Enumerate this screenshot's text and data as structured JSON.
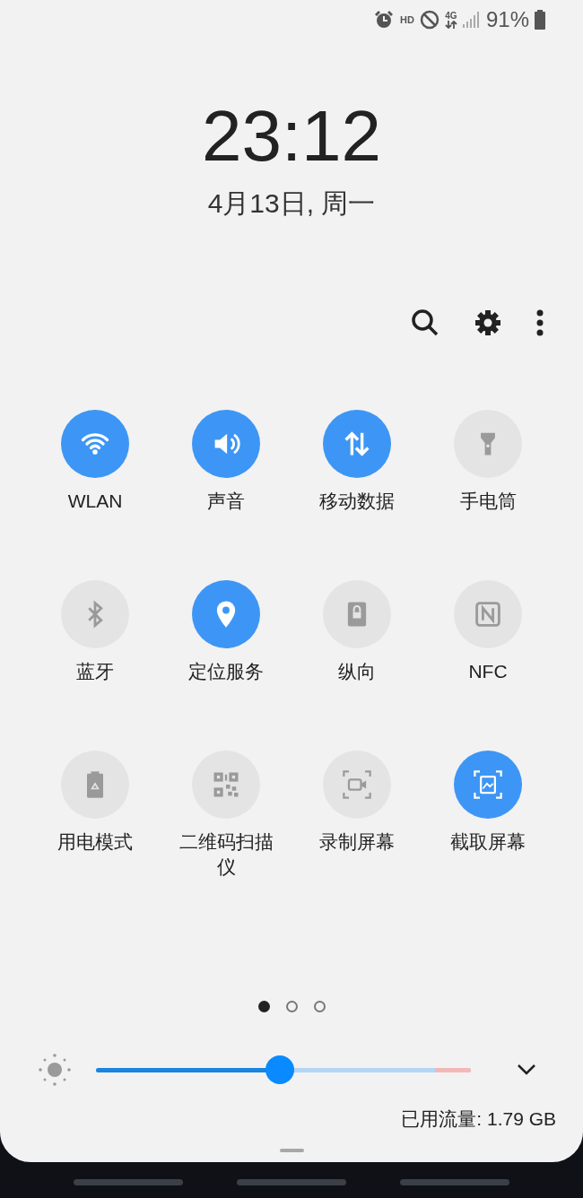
{
  "status_bar": {
    "hd": "HD",
    "network": "4G",
    "battery": "91%"
  },
  "clock": {
    "time": "23:12",
    "date": "4月13日, 周一"
  },
  "tiles": [
    {
      "label": "WLAN",
      "on": true
    },
    {
      "label": "声音",
      "on": true
    },
    {
      "label": "移动数据",
      "on": true
    },
    {
      "label": "手电筒",
      "on": false
    },
    {
      "label": "蓝牙",
      "on": false
    },
    {
      "label": "定位服务",
      "on": true
    },
    {
      "label": "纵向",
      "on": false
    },
    {
      "label": "NFC",
      "on": false
    },
    {
      "label": "用电模式",
      "on": false
    },
    {
      "label": "二维码扫描仪",
      "on": false
    },
    {
      "label": "录制屏幕",
      "on": false
    },
    {
      "label": "截取屏幕",
      "on": true
    }
  ],
  "pages": [
    {
      "selected": true
    },
    {
      "selected": false
    },
    {
      "selected": false
    }
  ],
  "brightness": {
    "level": 0.49
  },
  "data_usage": "已用流量: 1.79 GB"
}
